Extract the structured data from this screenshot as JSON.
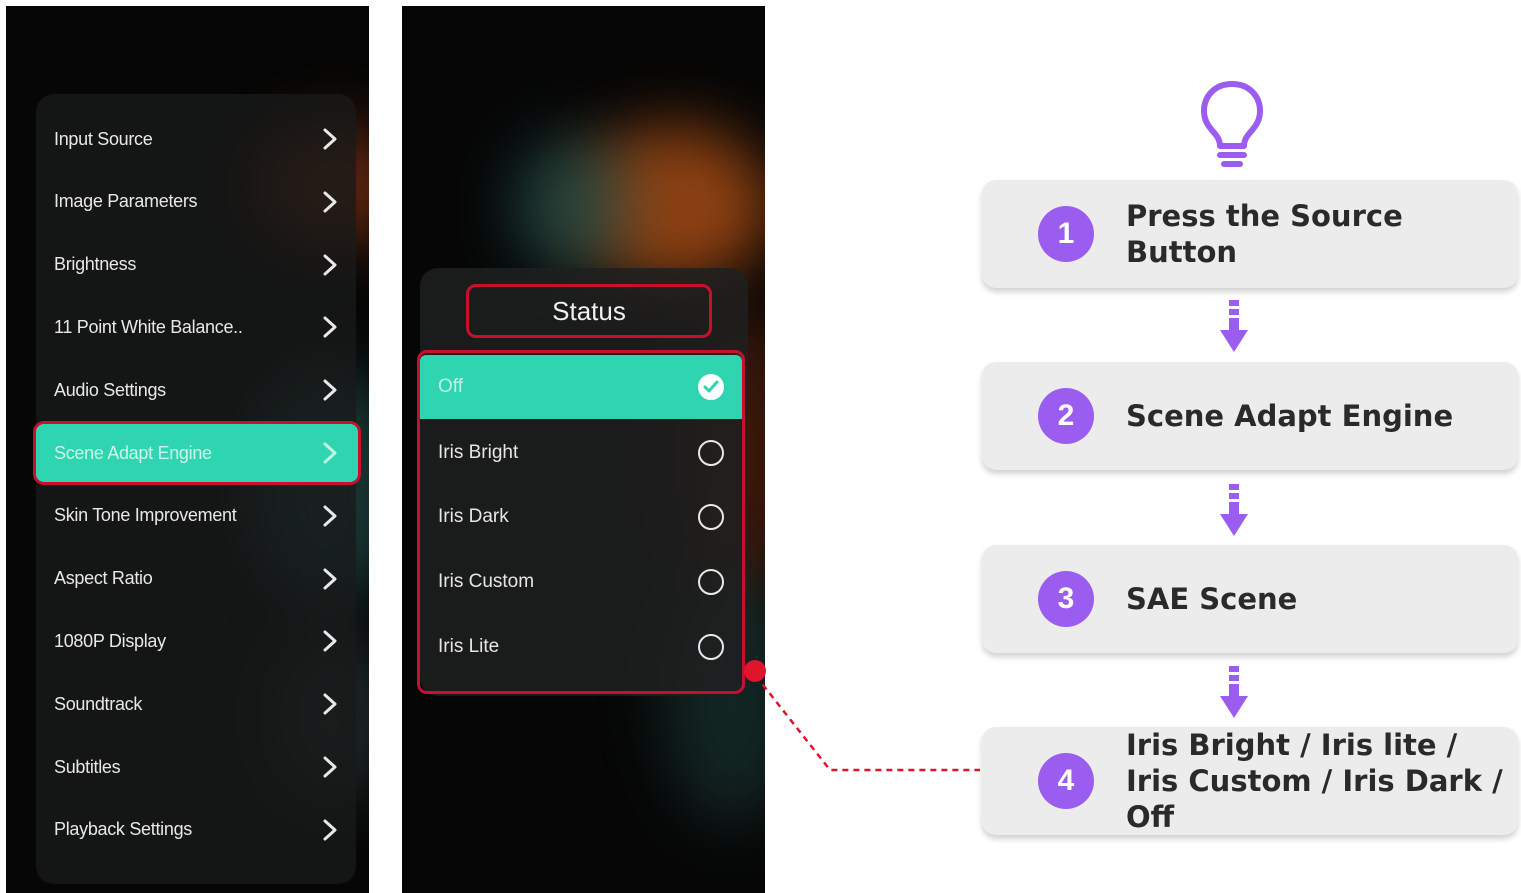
{
  "menu": {
    "items": [
      {
        "label": "Input Source"
      },
      {
        "label": "Image Parameters"
      },
      {
        "label": "Brightness"
      },
      {
        "label": "11 Point White Balance.."
      },
      {
        "label": "Audio Settings"
      },
      {
        "label": "Scene Adapt Engine",
        "active": true
      },
      {
        "label": "Skin Tone Improvement"
      },
      {
        "label": "Aspect Ratio"
      },
      {
        "label": "1080P Display"
      },
      {
        "label": "Soundtrack"
      },
      {
        "label": "Subtitles"
      },
      {
        "label": "Playback Settings"
      }
    ]
  },
  "status": {
    "title": "Status",
    "options": [
      {
        "label": "Off",
        "selected": true
      },
      {
        "label": "Iris Bright",
        "selected": false
      },
      {
        "label": "Iris Dark",
        "selected": false
      },
      {
        "label": "Iris Custom",
        "selected": false
      },
      {
        "label": "Iris Lite",
        "selected": false
      }
    ]
  },
  "steps": [
    {
      "number": "1",
      "text": "Press the Source Button"
    },
    {
      "number": "2",
      "text": "Scene Adapt Engine"
    },
    {
      "number": "3",
      "text": "SAE Scene"
    },
    {
      "number": "4",
      "text": "Iris Bright / Iris lite / Iris Custom / Iris Dark / Off"
    }
  ],
  "colors": {
    "accent_teal": "#2fd5b1",
    "highlight_red": "#c8102e",
    "step_purple": "#9b5cf0",
    "step_card": "#ececec"
  },
  "icons": [
    "chevron-right-icon",
    "checkmark-icon",
    "lightbulb-icon",
    "arrow-down-icon"
  ]
}
